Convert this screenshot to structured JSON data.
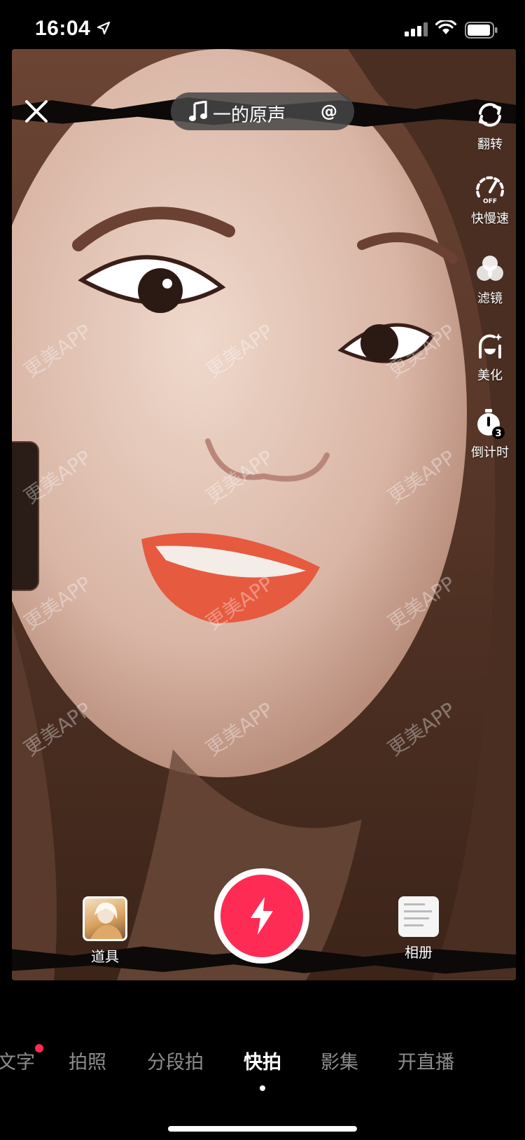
{
  "status_bar": {
    "time": "16:04"
  },
  "music": {
    "title": "一的原声",
    "mention_symbol": "@"
  },
  "tools": [
    {
      "label": "翻转",
      "icon": "flip-camera-icon"
    },
    {
      "label": "快慢速",
      "icon": "speed-icon",
      "badge": "OFF"
    },
    {
      "label": "滤镜",
      "icon": "filter-icon"
    },
    {
      "label": "美化",
      "icon": "beautify-icon"
    },
    {
      "label": "倒计时",
      "icon": "timer-icon",
      "badge": "3"
    }
  ],
  "bottom": {
    "props_label": "道具",
    "album_label": "相册"
  },
  "watermark": "更美APP",
  "modes": [
    {
      "label": "文字",
      "has_notification": true
    },
    {
      "label": "拍照"
    },
    {
      "label": "分段拍"
    },
    {
      "label": "快拍",
      "active": true
    },
    {
      "label": "影集"
    },
    {
      "label": "开直播"
    }
  ],
  "colors": {
    "accent": "#fe2c55"
  }
}
